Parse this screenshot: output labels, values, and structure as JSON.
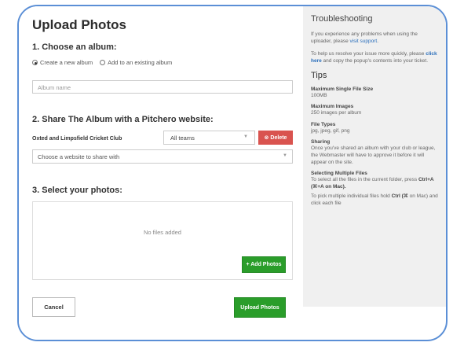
{
  "page": {
    "title": "Upload Photos",
    "step1_heading": "1. Choose an album:",
    "radio_new": "Create a new album",
    "radio_existing": "Add to an existing album",
    "album_placeholder": "Album name",
    "step2_heading": "2. Share The Album with a Pitchero website:",
    "club_name": "Oxted and Limpsfield Cricket Club",
    "teams_value": "All teams",
    "delete_label": "Delete",
    "website_select": "Choose a website to share with",
    "step3_heading": "3. Select your photos:",
    "no_files": "No files added",
    "add_photos_label": "+ Add Photos",
    "cancel_label": "Cancel",
    "upload_label": "Upload Photos"
  },
  "sidebar": {
    "troubleshooting_title": "Troubleshooting",
    "t1_pre": "If you experience any problems when using the uploader, please ",
    "t1_link": "visit support",
    "t1_post": ".",
    "t2_pre": "To help us resolve your issue more quickly, please ",
    "t2_link": "click here",
    "t2_post": " and copy the popup's contents into your ticket.",
    "tips_title": "Tips",
    "tips": [
      {
        "heading": "Maximum Single File Size",
        "text": "100MB"
      },
      {
        "heading": "Maximum Images",
        "text": "250 images per album"
      },
      {
        "heading": "File Types",
        "text": "jpg, jpeg, gif, png"
      },
      {
        "heading": "Sharing",
        "text": "Once you've shared an album with your club or league, the Webmaster will have to approve it before it will appear on the site."
      },
      {
        "heading": "Selecting Multiple Files",
        "text": "To select all the files in the current folder, press"
      }
    ],
    "select_all_keys": "Ctrl+A (⌘+A on Mac).",
    "multi_pre": "To pick multiple individual files hold ",
    "multi_key": "Ctrl (⌘",
    "multi_post": " on Mac) and click each file"
  },
  "colors": {
    "frame_border": "#5b8fd6",
    "green": "#2a9d2a",
    "red": "#d9534f",
    "link": "#2a6ebb"
  }
}
